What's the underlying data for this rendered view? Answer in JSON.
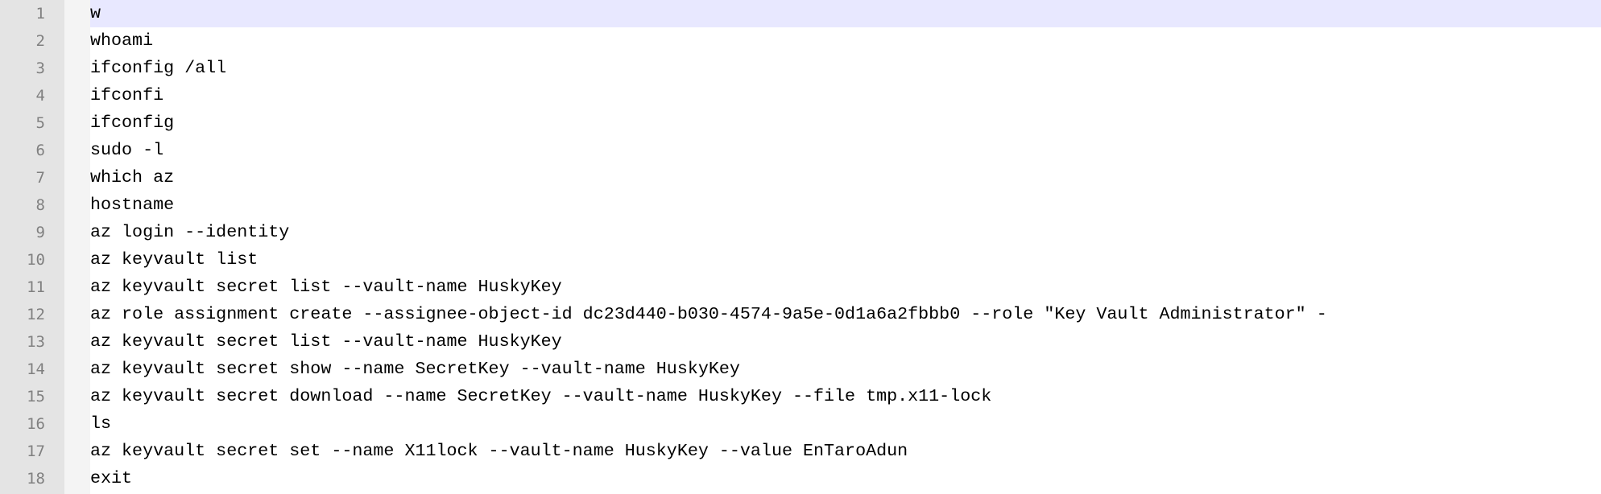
{
  "editor": {
    "current_line": 1,
    "lines": [
      {
        "number": "1",
        "text": "w"
      },
      {
        "number": "2",
        "text": "whoami"
      },
      {
        "number": "3",
        "text": "ifconfig /all"
      },
      {
        "number": "4",
        "text": "ifconfi"
      },
      {
        "number": "5",
        "text": "ifconfig"
      },
      {
        "number": "6",
        "text": "sudo -l"
      },
      {
        "number": "7",
        "text": "which az"
      },
      {
        "number": "8",
        "text": "hostname"
      },
      {
        "number": "9",
        "text": "az login --identity"
      },
      {
        "number": "10",
        "text": "az keyvault list"
      },
      {
        "number": "11",
        "text": "az keyvault secret list --vault-name HuskyKey"
      },
      {
        "number": "12",
        "text": "az role assignment create --assignee-object-id dc23d440-b030-4574-9a5e-0d1a6a2fbbb0 --role \"Key Vault Administrator\" -"
      },
      {
        "number": "13",
        "text": "az keyvault secret list --vault-name HuskyKey"
      },
      {
        "number": "14",
        "text": "az keyvault secret show --name SecretKey --vault-name HuskyKey"
      },
      {
        "number": "15",
        "text": "az keyvault secret download --name SecretKey --vault-name HuskyKey --file tmp.x11-lock"
      },
      {
        "number": "16",
        "text": "ls"
      },
      {
        "number": "17",
        "text": "az keyvault secret set --name X11lock --vault-name HuskyKey --value EnTaroAdun"
      },
      {
        "number": "18",
        "text": "exit"
      }
    ]
  }
}
